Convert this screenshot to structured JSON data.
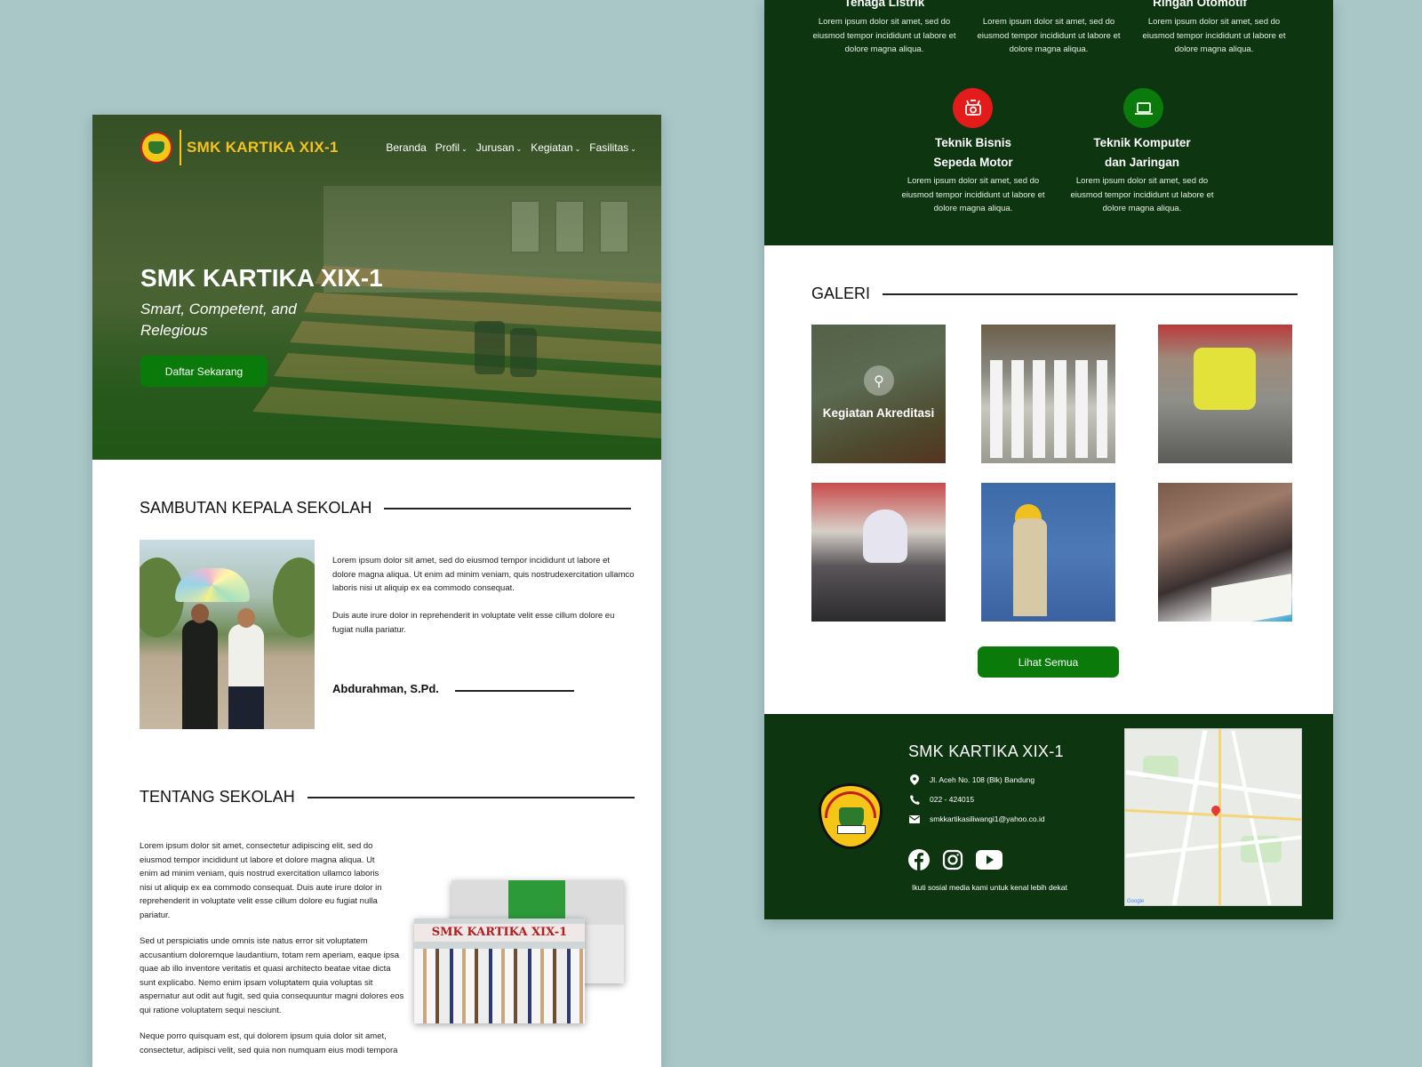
{
  "colors": {
    "background": "#a9c7c7",
    "brand_green": "#0c3510",
    "button_green": "#0a7a0a",
    "brand_gold": "#f6c21c",
    "accent_red": "#e31b1b"
  },
  "home": {
    "brand": "SMK KARTIKA XIX-1",
    "nav": [
      {
        "label": "Beranda",
        "dropdown": false
      },
      {
        "label": "Profil",
        "dropdown": true
      },
      {
        "label": "Jurusan",
        "dropdown": true
      },
      {
        "label": "Kegiatan",
        "dropdown": true
      },
      {
        "label": "Fasilitas",
        "dropdown": true
      }
    ],
    "hero": {
      "title": "SMK KARTIKA XIX-1",
      "subtitle": "Smart, Competent, and Relegious",
      "cta": "Daftar  Sekarang"
    },
    "sambutan": {
      "heading": "SAMBUTAN KEPALA SEKOLAH",
      "p1": "Lorem ipsum dolor sit amet, sed do eiusmod tempor incididunt ut labore et dolore magna aliqua. Ut enim ad minim veniam, quis nostrudexercitation ullamco laboris nisi ut aliquip ex ea commodo consequat.",
      "p2": "Duis aute irure dolor in reprehenderit in voluptate velit esse cillum dolore eu fugiat nulla pariatur.",
      "signature": "Abdurahman, S.Pd."
    },
    "tentang": {
      "heading": "TENTANG SEKOLAH",
      "p1": "Lorem ipsum dolor sit amet, consectetur adipiscing elit, sed do eiusmod tempor incididunt ut labore et dolore magna aliqua. Ut enim ad minim veniam, quis nostrud exercitation ullamco laboris nisi ut aliquip ex ea commodo consequat. Duis aute irure dolor in reprehenderit in voluptate velit esse cillum dolore eu fugiat nulla pariatur.",
      "p2": "Sed ut perspiciatis unde omnis iste natus error sit voluptatem accusantium doloremque laudantium, totam rem aperiam, eaque  ipsa quae ab illo inventore veritatis et quasi architecto beatae vitae dicta sunt explicabo. Nemo enim ipsam voluptatem quia voluptas sit aspernatur aut odit aut fugit, sed quia consequuntur magni dolores eos qui ratione voluptatem sequi nesciunt.",
      "p3": "Neque porro quisquam est, qui dolorem ipsum quia dolor sit amet, consectetur, adipisci velit, sed quia non numquam eius modi tempora",
      "photo_banner": "SMK KARTIKA XIX-1"
    }
  },
  "right": {
    "majors_top": [
      {
        "title": "Tenaga Listrik",
        "desc": "Lorem ipsum dolor sit amet, sed do eiusmod tempor incididunt ut labore et dolore magna aliqua."
      },
      {
        "title": "",
        "desc": "Lorem ipsum dolor sit amet, sed do eiusmod tempor incididunt ut labore et dolore magna aliqua."
      },
      {
        "title": "Ringan Otomotif",
        "desc": "Lorem ipsum dolor sit amet, sed do eiusmod tempor incididunt ut labore et dolore magna aliqua."
      }
    ],
    "majors_bottom": [
      {
        "title_line1": "Teknik Bisnis",
        "title_line2": "Sepeda Motor",
        "desc": "Lorem ipsum dolor sit amet, sed do eiusmod tempor incididunt ut labore et dolore magna aliqua.",
        "icon": "engine-icon",
        "color": "#e31b1b"
      },
      {
        "title_line1": "Teknik Komputer",
        "title_line2": "dan Jaringan",
        "desc": "Lorem ipsum dolor sit amet, sed do eiusmod tempor incididunt ut labore et dolore magna aliqua.",
        "icon": "laptop-icon",
        "color": "#0a7a0a"
      }
    ],
    "galeri": {
      "heading": "GALERI",
      "featured_caption": "Kegiatan Akreditasi",
      "button": "Lihat Semua"
    },
    "footer": {
      "brand": "SMK KARTIKA XIX-1",
      "address": "Jl. Aceh No. 108 (Blk) Bandung",
      "phone": "022 - 424015",
      "email": "smkkartikasiliwangi1@yahoo.co.id",
      "social_note": "Ikuti sosial media kami untuk kenal lebih dekat",
      "social": [
        "facebook-icon",
        "instagram-icon",
        "youtube-icon"
      ]
    }
  }
}
